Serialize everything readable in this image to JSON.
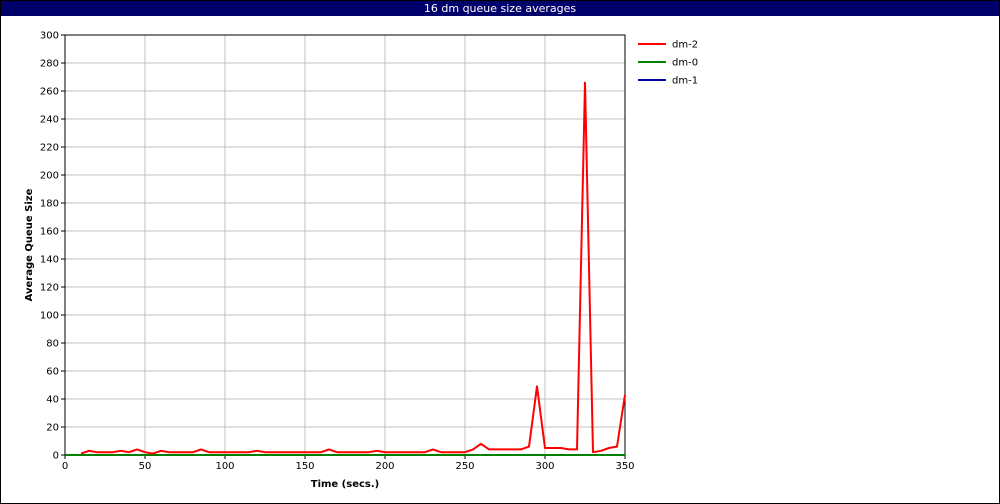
{
  "chart_data": {
    "type": "line",
    "title": "16 dm queue size averages",
    "xlabel": "Time (secs.)",
    "ylabel": "Average Queue Size",
    "xlim": [
      0,
      350
    ],
    "ylim": [
      0,
      300
    ],
    "xticks": [
      0,
      50,
      100,
      150,
      200,
      250,
      300,
      350
    ],
    "yticks": [
      0,
      20,
      40,
      60,
      80,
      100,
      120,
      140,
      160,
      180,
      200,
      220,
      240,
      260,
      280,
      300
    ],
    "grid": true,
    "legend_position": "right",
    "series": [
      {
        "name": "dm-2",
        "color": "#ff0000",
        "x": [
          10,
          15,
          20,
          25,
          30,
          35,
          40,
          45,
          50,
          55,
          60,
          65,
          70,
          75,
          80,
          85,
          90,
          95,
          100,
          105,
          110,
          115,
          120,
          125,
          130,
          135,
          140,
          145,
          150,
          155,
          160,
          165,
          170,
          175,
          180,
          185,
          190,
          195,
          200,
          205,
          210,
          215,
          220,
          225,
          230,
          235,
          240,
          245,
          250,
          255,
          260,
          265,
          270,
          275,
          280,
          285,
          290,
          295,
          300,
          305,
          310,
          315,
          320,
          325,
          330,
          335,
          340,
          345,
          350
        ],
        "y": [
          1,
          3,
          2,
          2,
          2,
          3,
          2,
          4,
          2,
          1,
          3,
          2,
          2,
          2,
          2,
          4,
          2,
          2,
          2,
          2,
          2,
          2,
          3,
          2,
          2,
          2,
          2,
          2,
          2,
          2,
          2,
          4,
          2,
          2,
          2,
          2,
          2,
          3,
          2,
          2,
          2,
          2,
          2,
          2,
          4,
          2,
          2,
          2,
          2,
          4,
          8,
          4,
          4,
          4,
          4,
          4,
          6,
          49,
          5,
          5,
          5,
          4,
          4,
          266,
          2,
          3,
          5,
          6,
          43
        ]
      },
      {
        "name": "dm-0",
        "color": "#008000",
        "x": [
          0,
          350
        ],
        "y": [
          0,
          0
        ]
      },
      {
        "name": "dm-1",
        "color": "#0000a0",
        "x": [
          0,
          350
        ],
        "y": [
          0,
          0
        ]
      }
    ]
  }
}
